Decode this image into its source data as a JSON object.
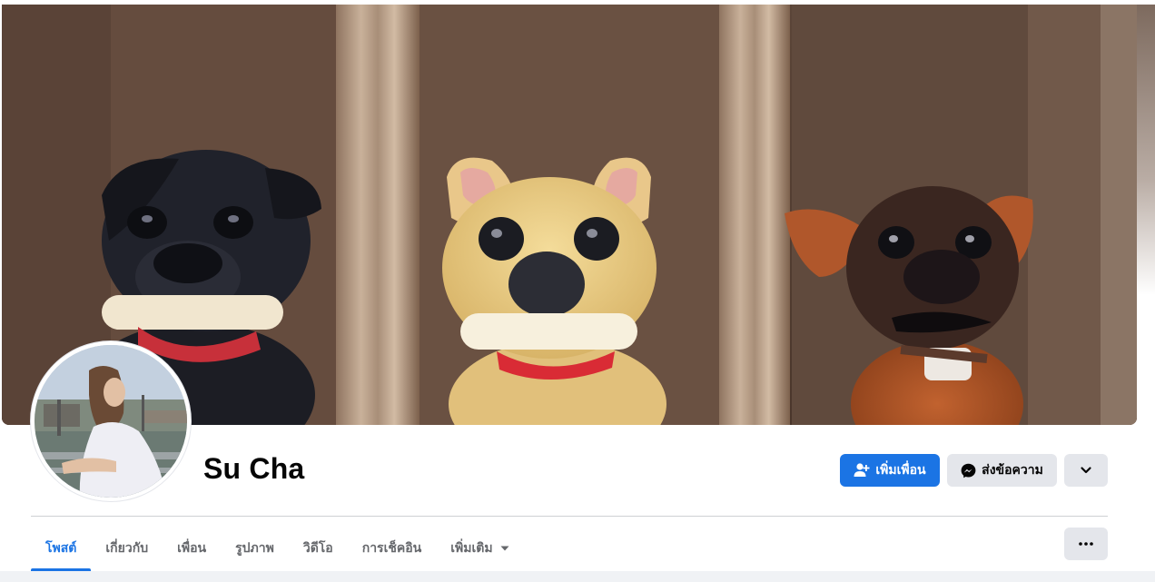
{
  "profile": {
    "name": "Su Cha"
  },
  "actions": {
    "add_friend_label": "เพิ่มเพื่อน",
    "message_label": "ส่งข้อความ"
  },
  "tabs": [
    {
      "label": "โพสต์",
      "active": true
    },
    {
      "label": "เกี่ยวกับ",
      "active": false
    },
    {
      "label": "เพื่อน",
      "active": false
    },
    {
      "label": "รูปภาพ",
      "active": false
    },
    {
      "label": "วิดีโอ",
      "active": false
    },
    {
      "label": "การเช็คอิน",
      "active": false
    },
    {
      "label": "เพิ่มเติม",
      "active": false
    }
  ],
  "icons": {
    "add_friend": "person-plus-icon",
    "messenger": "messenger-icon",
    "chevron": "chevron-down-icon",
    "caret": "caret-down-icon",
    "more": "more-dots-icon"
  },
  "colors": {
    "accent": "#1b74e4",
    "secondary_button": "#e4e6eb",
    "text_primary": "#050505",
    "text_secondary": "#65676b"
  }
}
